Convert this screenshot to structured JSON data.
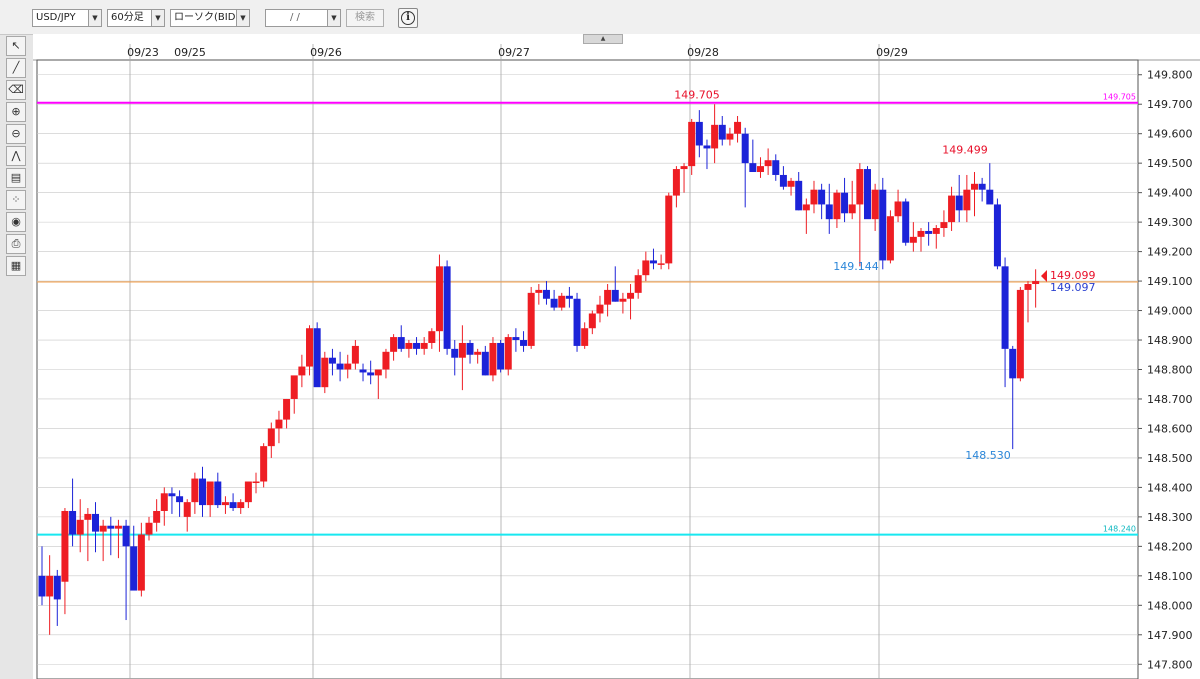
{
  "topbar": {
    "symbol": "USD/JPY",
    "interval": "60分足",
    "chart_kind": "ローソク(BID)",
    "date_value": "/  /",
    "search_label": "検索",
    "info_label": "i"
  },
  "toolbar": {
    "tools": [
      {
        "name": "cursor-tool",
        "glyph": "↖"
      },
      {
        "name": "draw-line-tool",
        "glyph": "╱"
      },
      {
        "name": "clear-all-tool",
        "glyph": "⌫"
      },
      {
        "name": "zoom-in-tool",
        "glyph": "⊕"
      },
      {
        "name": "zoom-out-tool",
        "glyph": "⊖"
      },
      {
        "name": "indicator-tool",
        "glyph": "⋀"
      },
      {
        "name": "values-tool",
        "glyph": "▤"
      },
      {
        "name": "settings-tool",
        "glyph": "⁘"
      },
      {
        "name": "view-tool",
        "glyph": "◉"
      },
      {
        "name": "print-tool",
        "glyph": "⎙"
      },
      {
        "name": "table-tool",
        "glyph": "▦"
      }
    ]
  },
  "colors": {
    "up": "#ee1d23",
    "down": "#1c23d8",
    "high_line": "#ff00ff",
    "low_line": "#18e8f0",
    "current_line": "#f0a050",
    "grid": "#c8c8c8",
    "label_high": "#e8102a",
    "label_low": "#2b86d8"
  },
  "chart_data": {
    "type": "candlestick",
    "ylim": [
      147.75,
      149.85
    ],
    "y_ticks": [
      "149.800",
      "149.700",
      "149.600",
      "149.500",
      "149.400",
      "149.300",
      "149.200",
      "149.100",
      "149.000",
      "148.900",
      "148.800",
      "148.700",
      "148.600",
      "148.500",
      "148.400",
      "148.300",
      "148.200",
      "148.100",
      "148.000",
      "147.900",
      "147.800"
    ],
    "x_labels": [
      "09/23",
      "09/25",
      "09/26",
      "09/27",
      "09/28",
      "09/29"
    ],
    "date_separators": [
      "09/23",
      "09/26",
      "09/27",
      "09/28",
      "09/29"
    ],
    "annotations": {
      "high": {
        "value": 149.705,
        "label": "149.705"
      },
      "high2": {
        "value": 149.499,
        "label": "149.499"
      },
      "low2": {
        "value": 149.144,
        "label": "149.144"
      },
      "low": {
        "value": 148.53,
        "label": "148.530"
      },
      "last_ask": {
        "label": "149.099"
      },
      "last_bid": {
        "label": "149.097"
      },
      "high_line": {
        "value": 149.705,
        "label": "149.705"
      },
      "low_line": {
        "value": 148.24,
        "label": "148.240"
      },
      "current_line": {
        "value": 149.097
      }
    },
    "candles": [
      [
        148.1,
        148.2,
        148.0,
        148.03
      ],
      [
        148.03,
        148.17,
        147.9,
        148.1
      ],
      [
        148.1,
        148.12,
        147.93,
        148.02
      ],
      [
        148.08,
        148.33,
        147.97,
        148.32
      ],
      [
        148.32,
        148.43,
        148.2,
        148.24
      ],
      [
        148.24,
        148.36,
        148.18,
        148.29
      ],
      [
        148.29,
        148.33,
        148.15,
        148.31
      ],
      [
        148.31,
        148.35,
        148.18,
        148.25
      ],
      [
        148.25,
        148.29,
        148.15,
        148.27
      ],
      [
        148.27,
        148.3,
        148.17,
        148.26
      ],
      [
        148.26,
        148.29,
        148.16,
        148.27
      ],
      [
        148.27,
        148.29,
        147.95,
        148.2
      ],
      [
        148.2,
        148.27,
        148.07,
        148.05
      ],
      [
        148.05,
        148.28,
        148.03,
        148.24
      ],
      [
        148.24,
        148.3,
        148.22,
        148.28
      ],
      [
        148.28,
        148.36,
        148.25,
        148.32
      ],
      [
        148.32,
        148.4,
        148.27,
        148.38
      ],
      [
        148.38,
        148.4,
        148.31,
        148.37
      ],
      [
        148.37,
        148.39,
        148.3,
        148.35
      ],
      [
        148.3,
        148.36,
        148.25,
        148.35
      ],
      [
        148.35,
        148.45,
        148.31,
        148.43
      ],
      [
        148.43,
        148.47,
        148.3,
        148.34
      ],
      [
        148.34,
        148.42,
        148.3,
        148.42
      ],
      [
        148.42,
        148.45,
        148.33,
        148.34
      ],
      [
        148.34,
        148.37,
        148.31,
        148.35
      ],
      [
        148.35,
        148.38,
        148.32,
        148.33
      ],
      [
        148.33,
        148.36,
        148.31,
        148.35
      ],
      [
        148.35,
        148.42,
        148.33,
        148.42
      ],
      [
        148.42,
        148.45,
        148.38,
        148.42
      ],
      [
        148.42,
        148.55,
        148.4,
        148.54
      ],
      [
        148.54,
        148.62,
        148.5,
        148.6
      ],
      [
        148.6,
        148.66,
        148.55,
        148.63
      ],
      [
        148.63,
        148.7,
        148.6,
        148.7
      ],
      [
        148.7,
        148.77,
        148.65,
        148.78
      ],
      [
        148.78,
        148.85,
        148.74,
        148.81
      ],
      [
        148.81,
        148.95,
        148.78,
        148.94
      ],
      [
        148.94,
        148.96,
        148.8,
        148.74
      ],
      [
        148.74,
        148.86,
        148.72,
        148.84
      ],
      [
        148.84,
        148.87,
        148.78,
        148.82
      ],
      [
        148.82,
        148.86,
        148.76,
        148.8
      ],
      [
        148.8,
        148.85,
        148.77,
        148.82
      ],
      [
        148.82,
        148.9,
        148.8,
        148.88
      ],
      [
        148.8,
        148.82,
        148.76,
        148.79
      ],
      [
        148.79,
        148.83,
        148.75,
        148.78
      ],
      [
        148.78,
        148.8,
        148.7,
        148.8
      ],
      [
        148.8,
        148.87,
        148.77,
        148.86
      ],
      [
        148.86,
        148.92,
        148.83,
        148.91
      ],
      [
        148.91,
        148.95,
        148.86,
        148.87
      ],
      [
        148.87,
        148.9,
        148.84,
        148.89
      ],
      [
        148.89,
        148.91,
        148.85,
        148.87
      ],
      [
        148.87,
        148.91,
        148.85,
        148.89
      ],
      [
        148.89,
        148.94,
        148.87,
        148.93
      ],
      [
        148.93,
        149.19,
        148.86,
        149.15
      ],
      [
        149.15,
        149.17,
        148.85,
        148.87
      ],
      [
        148.87,
        148.9,
        148.78,
        148.84
      ],
      [
        148.84,
        148.95,
        148.73,
        148.89
      ],
      [
        148.89,
        148.9,
        148.82,
        148.85
      ],
      [
        148.85,
        148.87,
        148.82,
        148.86
      ],
      [
        148.86,
        148.88,
        148.78,
        148.78
      ],
      [
        148.78,
        148.91,
        148.76,
        148.89
      ],
      [
        148.89,
        148.9,
        148.79,
        148.8
      ],
      [
        148.8,
        148.92,
        148.78,
        148.91
      ],
      [
        148.91,
        148.94,
        148.86,
        148.9
      ],
      [
        148.9,
        148.93,
        148.86,
        148.88
      ],
      [
        148.88,
        149.08,
        148.87,
        149.06
      ],
      [
        149.06,
        149.09,
        149.02,
        149.07
      ],
      [
        149.07,
        149.1,
        149.02,
        149.04
      ],
      [
        149.04,
        149.07,
        149.0,
        149.01
      ],
      [
        149.01,
        149.06,
        149.0,
        149.05
      ],
      [
        149.05,
        149.08,
        149.01,
        149.04
      ],
      [
        149.04,
        149.06,
        148.86,
        148.88
      ],
      [
        148.88,
        148.96,
        148.87,
        148.94
      ],
      [
        148.94,
        149.0,
        148.92,
        148.99
      ],
      [
        148.99,
        149.05,
        148.96,
        149.02
      ],
      [
        149.02,
        149.09,
        148.98,
        149.07
      ],
      [
        149.07,
        149.15,
        149.03,
        149.03
      ],
      [
        149.03,
        149.06,
        148.99,
        149.04
      ],
      [
        149.04,
        149.09,
        148.97,
        149.06
      ],
      [
        149.06,
        149.14,
        149.04,
        149.12
      ],
      [
        149.12,
        149.2,
        149.1,
        149.17
      ],
      [
        149.17,
        149.21,
        149.14,
        149.16
      ],
      [
        149.16,
        149.19,
        149.14,
        149.16
      ],
      [
        149.16,
        149.4,
        149.14,
        149.39
      ],
      [
        149.39,
        149.49,
        149.35,
        149.48
      ],
      [
        149.48,
        149.5,
        149.4,
        149.49
      ],
      [
        149.49,
        149.65,
        149.46,
        149.64
      ],
      [
        149.64,
        149.68,
        149.52,
        149.56
      ],
      [
        149.56,
        149.58,
        149.48,
        149.55
      ],
      [
        149.55,
        149.7,
        149.5,
        149.63
      ],
      [
        149.63,
        149.66,
        149.56,
        149.58
      ],
      [
        149.58,
        149.62,
        149.56,
        149.6
      ],
      [
        149.6,
        149.66,
        149.57,
        149.64
      ],
      [
        149.6,
        149.62,
        149.35,
        149.5
      ],
      [
        149.5,
        149.58,
        149.47,
        149.47
      ],
      [
        149.47,
        149.52,
        149.45,
        149.49
      ],
      [
        149.49,
        149.55,
        149.46,
        149.51
      ],
      [
        149.51,
        149.53,
        149.44,
        149.46
      ],
      [
        149.46,
        149.49,
        149.41,
        149.42
      ],
      [
        149.42,
        149.45,
        149.39,
        149.44
      ],
      [
        149.44,
        149.47,
        149.34,
        149.34
      ],
      [
        149.34,
        149.38,
        149.26,
        149.36
      ],
      [
        149.36,
        149.44,
        149.33,
        149.41
      ],
      [
        149.41,
        149.43,
        149.31,
        149.36
      ],
      [
        149.36,
        149.43,
        149.26,
        149.31
      ],
      [
        149.31,
        149.41,
        149.28,
        149.4
      ],
      [
        149.4,
        149.45,
        149.3,
        149.33
      ],
      [
        149.33,
        149.44,
        149.31,
        149.36
      ],
      [
        149.36,
        149.5,
        149.15,
        149.48
      ],
      [
        149.48,
        149.49,
        149.33,
        149.31
      ],
      [
        149.31,
        149.43,
        149.27,
        149.41
      ],
      [
        149.41,
        149.45,
        149.14,
        149.17
      ],
      [
        149.17,
        149.34,
        149.16,
        149.32
      ],
      [
        149.32,
        149.41,
        149.3,
        149.37
      ],
      [
        149.37,
        149.38,
        149.22,
        149.23
      ],
      [
        149.23,
        149.3,
        149.2,
        149.25
      ],
      [
        149.25,
        149.28,
        149.2,
        149.27
      ],
      [
        149.27,
        149.3,
        149.22,
        149.26
      ],
      [
        149.26,
        149.29,
        149.21,
        149.28
      ],
      [
        149.28,
        149.34,
        149.25,
        149.3
      ],
      [
        149.3,
        149.42,
        149.27,
        149.39
      ],
      [
        149.39,
        149.46,
        149.3,
        149.34
      ],
      [
        149.34,
        149.46,
        149.3,
        149.41
      ],
      [
        149.41,
        149.47,
        149.32,
        149.43
      ],
      [
        149.43,
        149.45,
        149.37,
        149.41
      ],
      [
        149.41,
        149.5,
        149.38,
        149.36
      ],
      [
        149.36,
        149.38,
        149.14,
        149.15
      ],
      [
        149.15,
        149.18,
        148.74,
        148.87
      ],
      [
        148.87,
        148.88,
        148.53,
        148.77
      ],
      [
        148.77,
        149.08,
        148.76,
        149.07
      ],
      [
        149.07,
        149.1,
        148.96,
        149.09
      ],
      [
        149.09,
        149.14,
        149.01,
        149.1
      ]
    ]
  }
}
